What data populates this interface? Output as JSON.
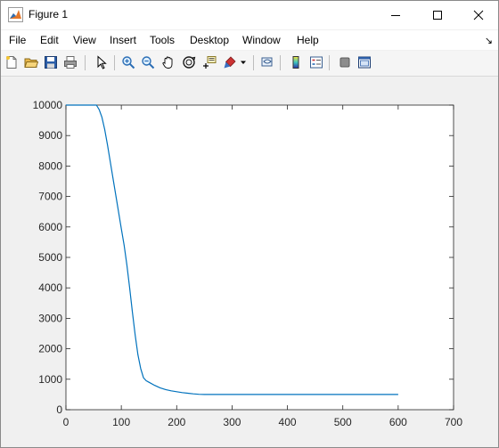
{
  "window": {
    "title": "Figure 1",
    "controls": [
      "minimize",
      "maximize",
      "close"
    ]
  },
  "menu": {
    "items": [
      "File",
      "Edit",
      "View",
      "Insert",
      "Tools",
      "Desktop",
      "Window",
      "Help"
    ],
    "overflow_arrow": "↘"
  },
  "toolbar": {
    "buttons": [
      {
        "icon": "new-figure-icon"
      },
      {
        "icon": "open-file-icon"
      },
      {
        "icon": "save-icon"
      },
      {
        "icon": "print-icon"
      },
      {
        "icon": "edit-plot-arrow-icon"
      },
      {
        "icon": "zoom-in-icon"
      },
      {
        "icon": "zoom-out-icon"
      },
      {
        "icon": "pan-hand-icon"
      },
      {
        "icon": "rotate-3d-icon"
      },
      {
        "icon": "data-cursor-icon"
      },
      {
        "icon": "brush-icon"
      },
      {
        "icon": "link-plot-icon"
      },
      {
        "icon": "colorbar-icon"
      },
      {
        "icon": "legend-icon"
      },
      {
        "icon": "hide-plot-tools-icon"
      },
      {
        "icon": "show-plot-tools-icon"
      }
    ]
  },
  "colors": {
    "line": "#0072bd",
    "axes_bg": "#ffffff",
    "figure_bg": "#f0f0f0",
    "axis_color": "#262626"
  },
  "chart_data": {
    "type": "line",
    "title": "",
    "xlabel": "",
    "ylabel": "",
    "xlim": [
      0,
      700
    ],
    "ylim": [
      0,
      10000
    ],
    "xticks": [
      0,
      100,
      200,
      300,
      400,
      500,
      600,
      700
    ],
    "yticks": [
      0,
      1000,
      2000,
      3000,
      4000,
      5000,
      6000,
      7000,
      8000,
      9000,
      10000
    ],
    "grid": false,
    "series": [
      {
        "x": [
          0,
          30,
          55,
          60,
          65,
          70,
          75,
          80,
          85,
          90,
          95,
          100,
          105,
          110,
          115,
          120,
          125,
          130,
          135,
          140,
          145,
          150,
          160,
          170,
          180,
          190,
          200,
          210,
          220,
          230,
          240,
          250,
          300,
          400,
          500,
          600
        ],
        "y": [
          10000,
          10000,
          10000,
          9850,
          9600,
          9200,
          8700,
          8150,
          7600,
          7050,
          6500,
          5950,
          5400,
          4750,
          4000,
          3200,
          2450,
          1800,
          1350,
          1050,
          950,
          900,
          800,
          720,
          660,
          620,
          590,
          560,
          540,
          520,
          505,
          500,
          500,
          500,
          500,
          500
        ]
      }
    ]
  }
}
